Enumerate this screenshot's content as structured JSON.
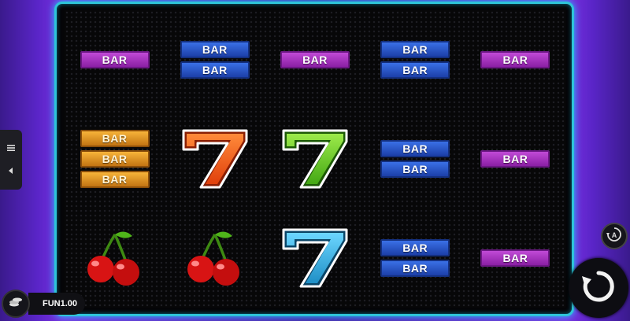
{
  "game": {
    "bar_label": "BAR",
    "balance_label": "FUN1.00",
    "reels": [
      [
        {
          "symbol": "bar",
          "count": 1,
          "color": "purple"
        },
        {
          "symbol": "bar",
          "count": 3,
          "color": "gold"
        },
        {
          "symbol": "cherry"
        }
      ],
      [
        {
          "symbol": "bar",
          "count": 2,
          "color": "blue"
        },
        {
          "symbol": "seven",
          "color": "orange"
        },
        {
          "symbol": "cherry"
        }
      ],
      [
        {
          "symbol": "bar",
          "count": 1,
          "color": "purple"
        },
        {
          "symbol": "seven",
          "color": "green"
        },
        {
          "symbol": "seven",
          "color": "blue"
        }
      ],
      [
        {
          "symbol": "bar",
          "count": 2,
          "color": "blue"
        },
        {
          "symbol": "bar",
          "count": 2,
          "color": "blue"
        },
        {
          "symbol": "bar",
          "count": 2,
          "color": "blue"
        }
      ],
      [
        {
          "symbol": "bar",
          "count": 1,
          "color": "purple"
        },
        {
          "symbol": "bar",
          "count": 1,
          "color": "purple"
        },
        {
          "symbol": "bar",
          "count": 1,
          "color": "purple"
        }
      ]
    ]
  },
  "colors": {
    "frame": "#2ec4d8",
    "bar_purple": "#a335c0",
    "bar_blue": "#2a56c8",
    "bar_gold": "#e0921f",
    "seven_orange": "#f2631c",
    "seven_green": "#5cc11d",
    "seven_blue": "#2aa6d8",
    "cherry_red": "#e01818"
  },
  "icons": {
    "menu": "hamburger-icon",
    "collapse": "triangle-left-icon",
    "autoplay": "autoplay-icon",
    "spin": "spin-arrow-icon",
    "coins": "coin-stack-icon"
  }
}
